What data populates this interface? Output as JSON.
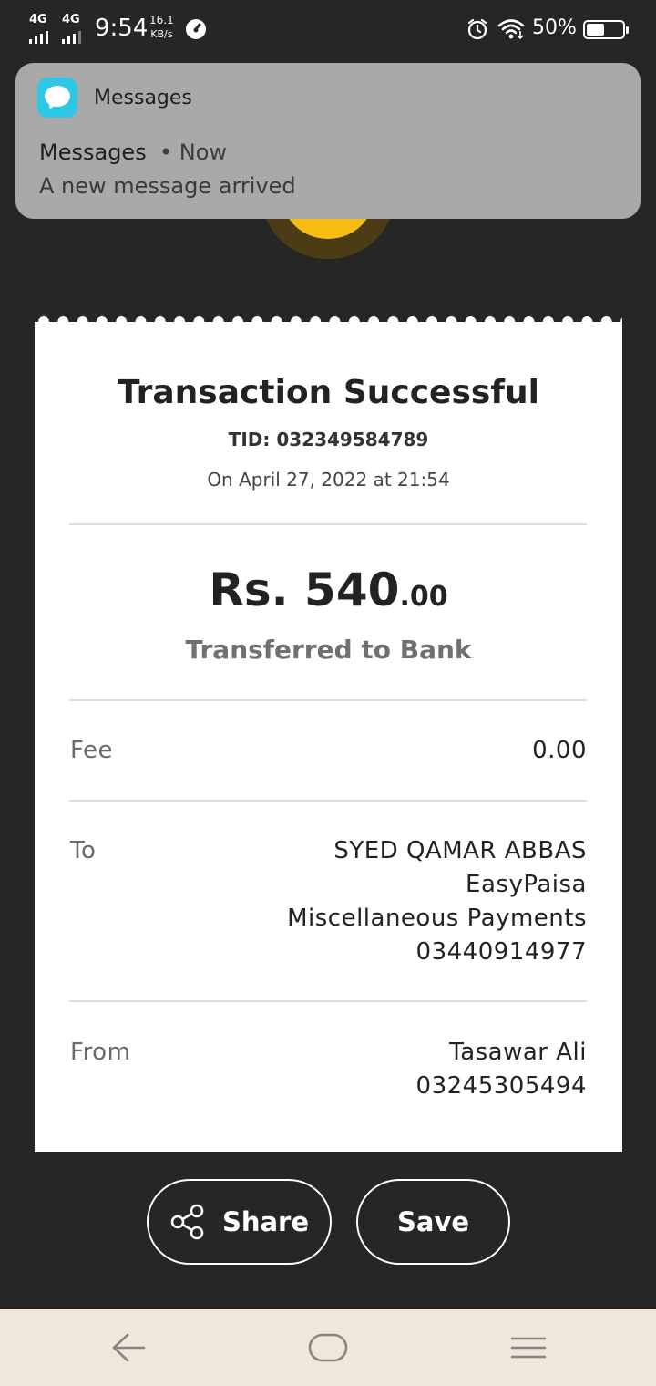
{
  "status_bar": {
    "network1": "4G",
    "network2": "4G",
    "time": "9:54",
    "speed_value": "16.1",
    "speed_unit": "KB/s",
    "battery_percent": "50%",
    "battery_level": 0.5,
    "icons": [
      "signal-icon",
      "gauge-icon",
      "alarm-icon",
      "wifi-icon",
      "battery-icon"
    ]
  },
  "notification": {
    "app_name": "Messages",
    "title": "Messages",
    "time": "• Now",
    "body": "A new message arrived",
    "icon": "messages-app-icon"
  },
  "receipt": {
    "title": "Transaction Successful",
    "tid": "TID: 032349584789",
    "date": "On April 27, 2022 at 21:54",
    "amount_main": "Rs. 540",
    "amount_decimal": ".00",
    "method": "Transferred to Bank",
    "fee_label": "Fee",
    "fee_value": "0.00",
    "to_label": "To",
    "to_lines": [
      "SYED QAMAR ABBAS",
      "EasyPaisa",
      "Miscellaneous Payments",
      "03440914977"
    ],
    "from_label": "From",
    "from_lines": [
      "Tasawar Ali",
      "03245305494"
    ]
  },
  "actions": {
    "share_label": "Share",
    "save_label": "Save"
  },
  "colors": {
    "background": "#262626",
    "accent_yellow": "#f6bd14",
    "app_icon": "#2ec7e6",
    "navbar": "#f0e6db"
  },
  "navbar": {
    "items": [
      "back-icon",
      "home-icon",
      "menu-icon"
    ]
  }
}
